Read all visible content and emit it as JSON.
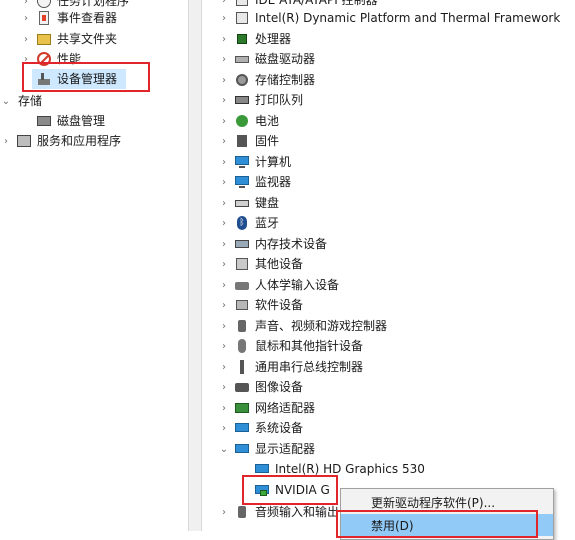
{
  "left_tree": [
    {
      "label": "任务计划程序",
      "icon": "clock-icon",
      "chevron": "right"
    },
    {
      "label": "事件查看器",
      "icon": "event-viewer-icon",
      "chevron": "right"
    },
    {
      "label": "共享文件夹",
      "icon": "shared-folder-icon",
      "chevron": "right"
    },
    {
      "label": "性能",
      "icon": "performance-icon",
      "chevron": "right"
    },
    {
      "label": "设备管理器",
      "icon": "device-manager-icon",
      "chevron": ""
    },
    {
      "label": "存储",
      "icon": "",
      "chevron": "down"
    },
    {
      "label": "磁盘管理",
      "icon": "disk-management-icon",
      "chevron": ""
    },
    {
      "label": "服务和应用程序",
      "icon": "services-icon",
      "chevron": "right"
    }
  ],
  "device_tree": [
    {
      "label": "IDE ATA/ATAPI 控制器",
      "icon": "ide-icon"
    },
    {
      "label": "Intel(R) Dynamic Platform and Thermal Framework",
      "icon": "thermal-icon"
    },
    {
      "label": "处理器",
      "icon": "processor-icon"
    },
    {
      "label": "磁盘驱动器",
      "icon": "disk-drive-icon"
    },
    {
      "label": "存储控制器",
      "icon": "storage-controller-icon"
    },
    {
      "label": "打印队列",
      "icon": "printer-icon"
    },
    {
      "label": "电池",
      "icon": "battery-icon"
    },
    {
      "label": "固件",
      "icon": "firmware-icon"
    },
    {
      "label": "计算机",
      "icon": "computer-icon"
    },
    {
      "label": "监视器",
      "icon": "monitor-icon"
    },
    {
      "label": "键盘",
      "icon": "keyboard-icon"
    },
    {
      "label": "蓝牙",
      "icon": "bluetooth-icon"
    },
    {
      "label": "内存技术设备",
      "icon": "memory-icon"
    },
    {
      "label": "其他设备",
      "icon": "other-devices-icon"
    },
    {
      "label": "人体学输入设备",
      "icon": "hid-icon"
    },
    {
      "label": "软件设备",
      "icon": "software-device-icon"
    },
    {
      "label": "声音、视频和游戏控制器",
      "icon": "audio-icon"
    },
    {
      "label": "鼠标和其他指针设备",
      "icon": "mouse-icon"
    },
    {
      "label": "通用串行总线控制器",
      "icon": "usb-icon"
    },
    {
      "label": "图像设备",
      "icon": "camera-icon"
    },
    {
      "label": "网络适配器",
      "icon": "network-adapter-icon"
    },
    {
      "label": "系统设备",
      "icon": "system-device-icon"
    },
    {
      "label": "显示适配器",
      "icon": "display-adapter-icon"
    }
  ],
  "display_children": [
    {
      "label": "Intel(R) HD Graphics 530"
    },
    {
      "label": "NVIDIA G"
    }
  ],
  "partial_row": {
    "label": "音频输入和输出"
  },
  "context_menu": {
    "items": [
      {
        "label": "更新驱动程序软件(P)..."
      },
      {
        "label": "禁用(D)"
      }
    ]
  },
  "colors": {
    "highlight_red": "#e0252b",
    "menu_active": "#91c9f7",
    "selection": "#cde8ff"
  }
}
